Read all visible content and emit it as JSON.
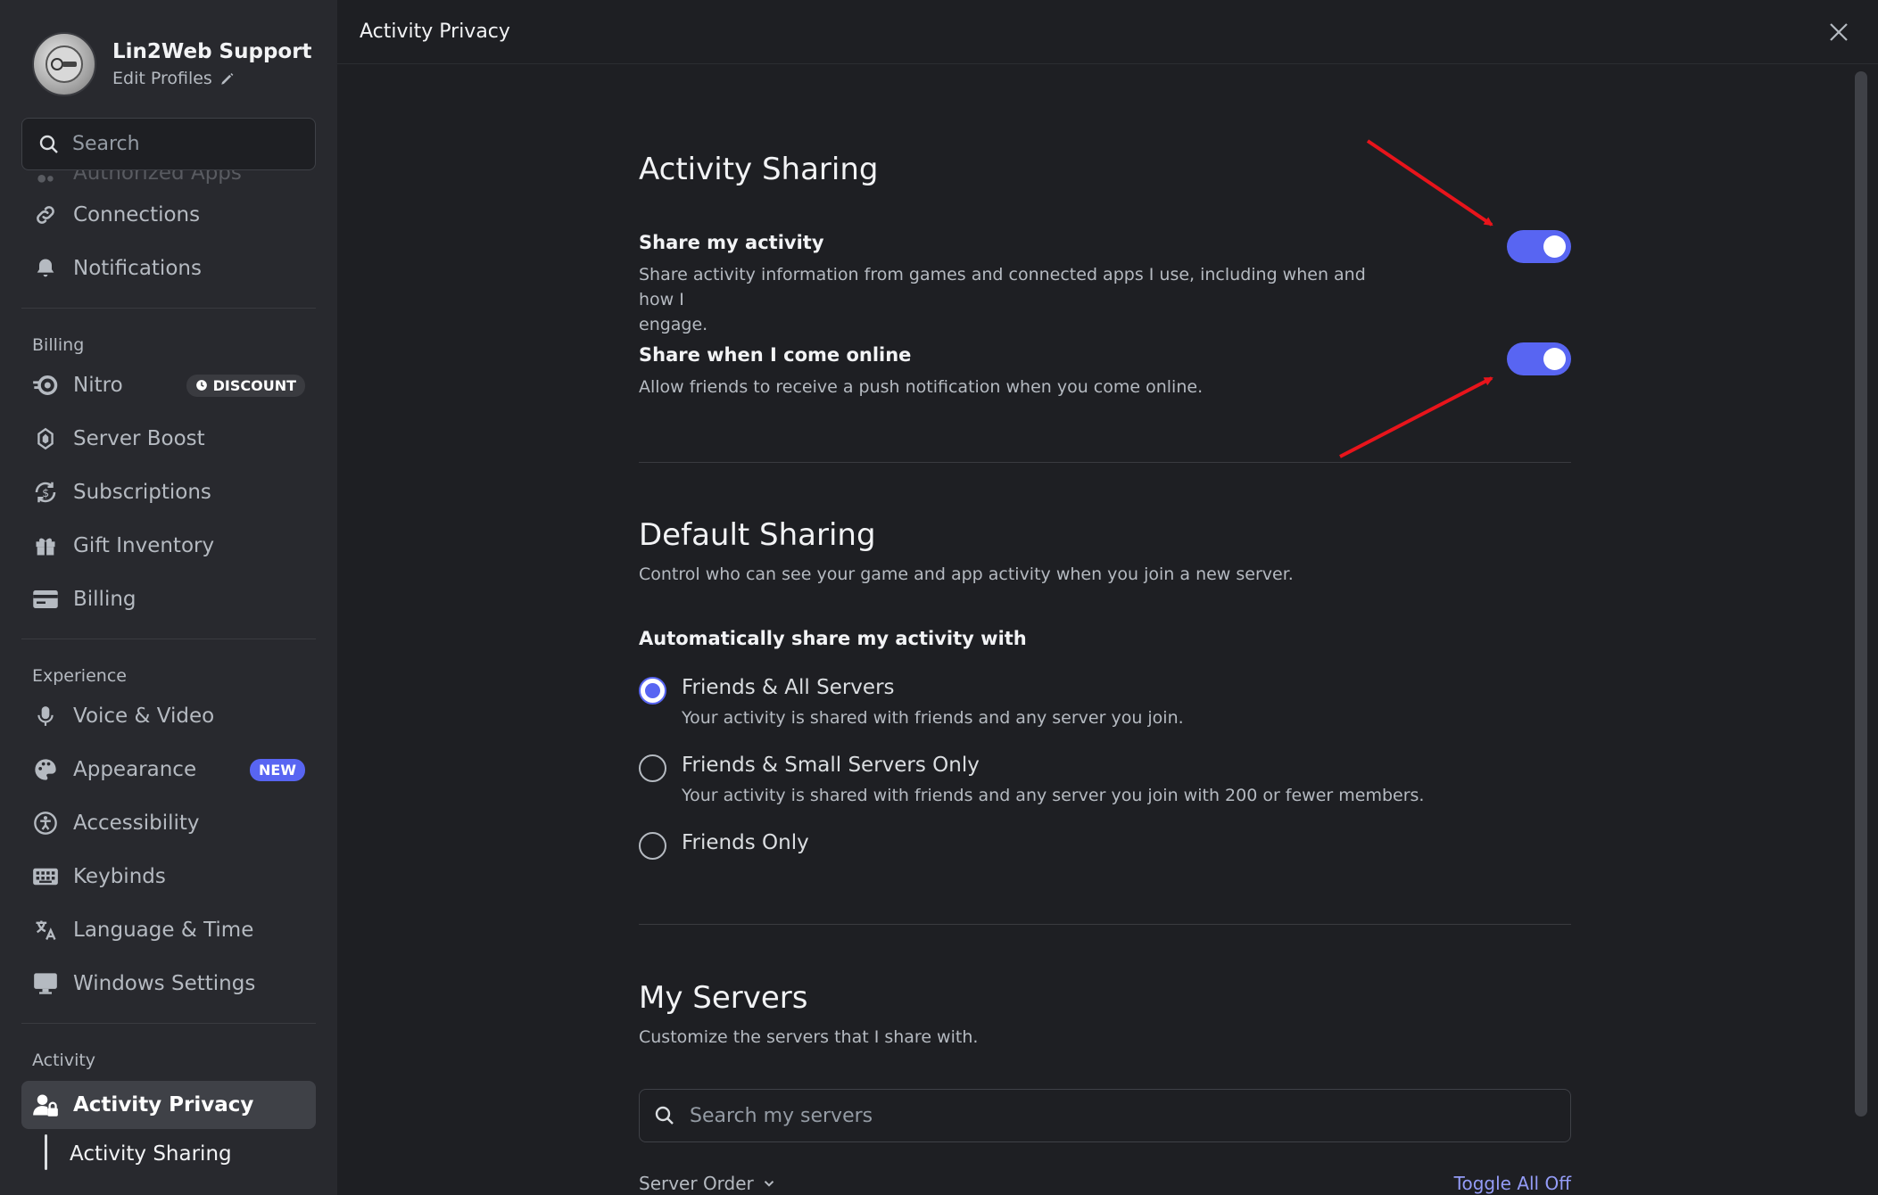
{
  "header": {
    "title": "Activity Privacy"
  },
  "profile": {
    "name": "Lin2Web Support",
    "edit_label": "Edit Profiles"
  },
  "search": {
    "placeholder": "Search"
  },
  "sidebar": {
    "partial_item": "Authorized Apps",
    "top_items": [
      {
        "label": "Connections",
        "icon": "link-icon"
      },
      {
        "label": "Notifications",
        "icon": "bell-icon"
      }
    ],
    "billing": {
      "heading": "Billing",
      "items": [
        {
          "label": "Nitro",
          "icon": "nitro-icon",
          "badge": "DISCOUNT"
        },
        {
          "label": "Server Boost",
          "icon": "boost-icon"
        },
        {
          "label": "Subscriptions",
          "icon": "subscriptions-icon"
        },
        {
          "label": "Gift Inventory",
          "icon": "gift-icon"
        },
        {
          "label": "Billing",
          "icon": "card-icon"
        }
      ]
    },
    "experience": {
      "heading": "Experience",
      "items": [
        {
          "label": "Voice & Video",
          "icon": "mic-icon"
        },
        {
          "label": "Appearance",
          "icon": "palette-icon",
          "badge": "NEW"
        },
        {
          "label": "Accessibility",
          "icon": "accessibility-icon"
        },
        {
          "label": "Keybinds",
          "icon": "keyboard-icon"
        },
        {
          "label": "Language & Time",
          "icon": "translate-icon"
        },
        {
          "label": "Windows Settings",
          "icon": "monitor-icon"
        }
      ]
    },
    "activity": {
      "heading": "Activity",
      "active_item": "Activity Privacy",
      "sub_item": "Activity Sharing"
    }
  },
  "activity_sharing": {
    "title": "Activity Sharing",
    "share_activity": {
      "label": "Share my activity",
      "desc_line1": "Share activity information from games and connected apps I use, including when and how I",
      "desc_line2": "engage.",
      "enabled": true
    },
    "share_online": {
      "label": "Share when I come online",
      "desc": "Allow friends to receive a push notification when you come online.",
      "enabled": true
    }
  },
  "default_sharing": {
    "title": "Default Sharing",
    "desc": "Control who can see your game and app activity when you join a new server.",
    "question": "Automatically share my activity with",
    "options": [
      {
        "label": "Friends & All Servers",
        "desc": "Your activity is shared with friends and any server you join.",
        "selected": true
      },
      {
        "label": "Friends & Small Servers Only",
        "desc": "Your activity is shared with friends and any server you join with 200 or fewer members.",
        "selected": false
      },
      {
        "label": "Friends Only",
        "desc": "",
        "selected": false
      }
    ]
  },
  "my_servers": {
    "title": "My Servers",
    "desc": "Customize the servers that I share with.",
    "search_placeholder": "Search my servers",
    "order_label": "Server Order",
    "toggle_all": "Toggle All Off"
  },
  "colors": {
    "accent": "#5865f2",
    "annotation_arrow": "#e8141b"
  }
}
